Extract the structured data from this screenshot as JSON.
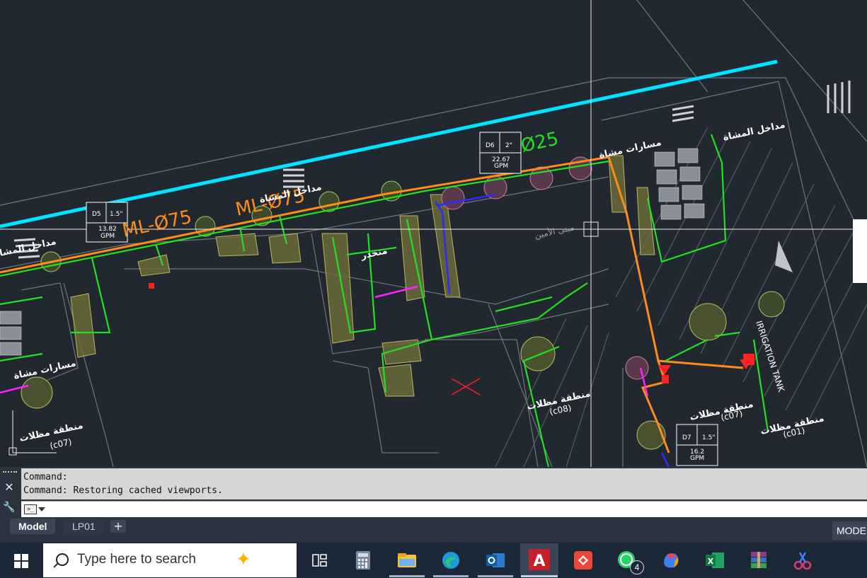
{
  "drawing": {
    "labels_ar": {
      "pedestrian_entrances_1": "مداخل المشاة",
      "pedestrian_entrances_2": "مداخل المشاة",
      "pedestrian_entrances_3": "مداخل المشاة",
      "pedestrian_paths_1": "مسارات مشاة",
      "pedestrian_paths_2": "مسارات مشاة",
      "shaded_area_c08": "منطقة مظلات",
      "shaded_area_c07a": "منطقة مظلات",
      "shaded_area_c07b": "منطقة مظلات",
      "shaded_area_c01": "منطقة مظلات",
      "slope": "منحدر",
      "building": "مبنى الأمين"
    },
    "zone_codes": {
      "c08": "(c08)",
      "c07a": "(c07)",
      "c07b": "(c07)",
      "c01": "(c01)"
    },
    "irrigation_tank": "IRRIGATION TANK",
    "pipes": {
      "ml_left": "ML-Ø75",
      "ml_right": "ML-Ø75",
      "pipe_d25": "Ø25"
    },
    "valve_boxes": [
      {
        "id": "D5",
        "size": "1.5\"",
        "flow": "13.82",
        "unit": "GPM"
      },
      {
        "id": "D6",
        "size": "2\"",
        "flow": "22.67",
        "unit": "GPM"
      },
      {
        "id": "D7",
        "size": "1.5\"",
        "flow": "16.2",
        "unit": "GPM"
      }
    ],
    "colors": {
      "background": "#212830",
      "road_line": "#00e5ff",
      "main_line": "#ff8c1a",
      "lateral": "#22e022",
      "drip": "#2b2bff",
      "magenta": "#ff22ff",
      "valve": "#ff2020",
      "outline": "#9aa0a8"
    }
  },
  "command_line": {
    "history": [
      "Command:",
      "Command: Restoring cached viewports."
    ],
    "prompt_icon": ">_"
  },
  "layout_tabs": {
    "model": "Model",
    "lp01": "LP01",
    "add": "+"
  },
  "status_bar": {
    "model_toggle": "MODEL"
  },
  "taskbar": {
    "search_placeholder": "Type here to search",
    "whatsapp_badge": "4",
    "apps": [
      "task-view",
      "calculator",
      "file-explorer",
      "edge",
      "outlook",
      "autocad",
      "anydesk",
      "whatsapp",
      "copilot",
      "excel",
      "winrar",
      "snipping-tool"
    ]
  }
}
